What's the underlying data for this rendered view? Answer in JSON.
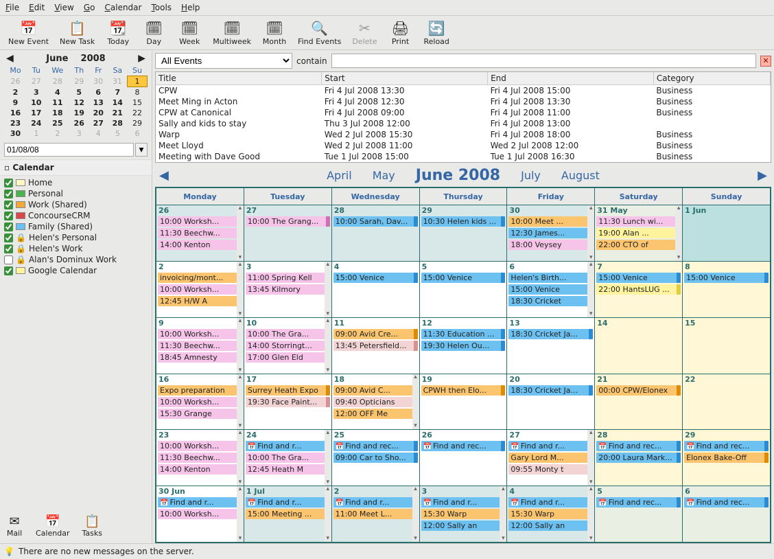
{
  "menubar": [
    "File",
    "Edit",
    "View",
    "Go",
    "Calendar",
    "Tools",
    "Help"
  ],
  "toolbar": [
    {
      "id": "new-event",
      "label": "New Event",
      "icon": "📅"
    },
    {
      "id": "new-task",
      "label": "New Task",
      "icon": "📋"
    },
    {
      "id": "today",
      "label": "Today",
      "icon": "📆"
    },
    {
      "id": "day",
      "label": "Day",
      "icon": "🗓"
    },
    {
      "id": "week",
      "label": "Week",
      "icon": "🗓"
    },
    {
      "id": "multiweek",
      "label": "Multiweek",
      "icon": "🗓"
    },
    {
      "id": "month",
      "label": "Month",
      "icon": "🗓"
    },
    {
      "id": "find-events",
      "label": "Find Events",
      "icon": "🔍"
    },
    {
      "id": "delete",
      "label": "Delete",
      "icon": "✂",
      "disabled": true
    },
    {
      "id": "print",
      "label": "Print",
      "icon": "🖨"
    },
    {
      "id": "reload",
      "label": "Reload",
      "icon": "🔄"
    }
  ],
  "minical": {
    "month": "June",
    "year": "2008",
    "dow": [
      "Mo",
      "Tu",
      "We",
      "Th",
      "Fr",
      "Sa",
      "Su"
    ],
    "rows": [
      [
        {
          "n": "26",
          "g": true
        },
        {
          "n": "27",
          "g": true
        },
        {
          "n": "28",
          "g": true
        },
        {
          "n": "29",
          "g": true
        },
        {
          "n": "30",
          "g": true
        },
        {
          "n": "31",
          "g": true
        },
        {
          "n": "1",
          "sel": true
        }
      ],
      [
        {
          "n": "2",
          "b": true
        },
        {
          "n": "3",
          "b": true
        },
        {
          "n": "4",
          "b": true
        },
        {
          "n": "5",
          "b": true
        },
        {
          "n": "6",
          "b": true
        },
        {
          "n": "7",
          "b": true
        },
        {
          "n": "8"
        }
      ],
      [
        {
          "n": "9",
          "b": true
        },
        {
          "n": "10",
          "b": true
        },
        {
          "n": "11",
          "b": true
        },
        {
          "n": "12",
          "b": true
        },
        {
          "n": "13",
          "b": true
        },
        {
          "n": "14",
          "b": true
        },
        {
          "n": "15"
        }
      ],
      [
        {
          "n": "16",
          "b": true
        },
        {
          "n": "17",
          "b": true
        },
        {
          "n": "18",
          "b": true
        },
        {
          "n": "19",
          "b": true
        },
        {
          "n": "20",
          "b": true
        },
        {
          "n": "21",
          "b": true
        },
        {
          "n": "22"
        }
      ],
      [
        {
          "n": "23",
          "b": true
        },
        {
          "n": "24",
          "b": true
        },
        {
          "n": "25",
          "b": true
        },
        {
          "n": "26",
          "b": true
        },
        {
          "n": "27",
          "b": true
        },
        {
          "n": "28",
          "b": true
        },
        {
          "n": "29"
        }
      ],
      [
        {
          "n": "30",
          "b": true
        },
        {
          "n": "1",
          "g": true
        },
        {
          "n": "2",
          "g": true
        },
        {
          "n": "3",
          "g": true
        },
        {
          "n": "4",
          "g": true
        },
        {
          "n": "5",
          "g": true
        },
        {
          "n": "6",
          "g": true
        }
      ]
    ]
  },
  "date_input": "01/08/08",
  "sidebar_title": "Calendar",
  "calendars": [
    {
      "name": "Home",
      "color": "#fff8c4",
      "checked": true
    },
    {
      "name": "Personal",
      "color": "#4bb34b",
      "checked": true
    },
    {
      "name": "Work (Shared)",
      "color": "#f6a93b",
      "checked": true
    },
    {
      "name": "ConcourseCRM",
      "color": "#d94848",
      "checked": true
    },
    {
      "name": "Family (Shared)",
      "color": "#6dc1f0",
      "checked": true
    },
    {
      "name": "Helen's Personal",
      "color": "#ffffff",
      "checked": true,
      "lock": true
    },
    {
      "name": "Helen's Work",
      "color": "#ffffff",
      "checked": true,
      "lock": true
    },
    {
      "name": "Alan's Dominux Work",
      "color": "#ffffff",
      "checked": false,
      "lock": true
    },
    {
      "name": "Google Calendar",
      "color": "#fff49d",
      "checked": true
    }
  ],
  "switcher": [
    {
      "id": "mail",
      "label": "Mail",
      "icon": "✉"
    },
    {
      "id": "calendar",
      "label": "Calendar",
      "icon": "📅"
    },
    {
      "id": "tasks",
      "label": "Tasks",
      "icon": "📋"
    }
  ],
  "filter": {
    "dropdown": "All Events",
    "label": "contain",
    "value": ""
  },
  "eventlist": {
    "cols": [
      "Title",
      "Start",
      "End",
      "Category"
    ],
    "rows": [
      [
        "CPW",
        "Fri 4 Jul 2008 13:30",
        "Fri 4 Jul 2008 15:00",
        "Business"
      ],
      [
        "Meet Ming in Acton",
        "Fri 4 Jul 2008 12:30",
        "Fri 4 Jul 2008 13:30",
        "Business"
      ],
      [
        "CPW at Canonical",
        "Fri 4 Jul 2008 09:00",
        "Fri 4 Jul 2008 11:00",
        "Business"
      ],
      [
        "Sally and kids to stay",
        "Thu 3 Jul 2008 12:00",
        "Fri 4 Jul 2008 13:00",
        ""
      ],
      [
        "Warp",
        "Wed 2 Jul 2008 15:30",
        "Fri 4 Jul 2008 18:00",
        "Business"
      ],
      [
        "Meet Lloyd",
        "Wed 2 Jul 2008 11:00",
        "Wed 2 Jul 2008 12:00",
        "Business"
      ],
      [
        "Meeting with Dave Good",
        "Tue 1 Jul 2008 15:00",
        "Tue 1 Jul 2008 16:30",
        "Business"
      ]
    ]
  },
  "monthnav": {
    "prev2": "April",
    "prev": "May",
    "cur": "June 2008",
    "next": "July",
    "next2": "August"
  },
  "daynames": [
    "Monday",
    "Tuesday",
    "Wednesday",
    "Thursday",
    "Friday",
    "Saturday",
    "Sunday"
  ],
  "weeks": [
    [
      {
        "n": "26",
        "out": true,
        "sc": true,
        "ev": [
          {
            "t": "10:00 Worksh...",
            "c": "pink"
          },
          {
            "t": "11:30 Beechw...",
            "c": "pink"
          },
          {
            "t": "14:00 Kenton",
            "c": "pink"
          }
        ]
      },
      {
        "n": "27",
        "out": true,
        "ev": [
          {
            "t": "10:00 The Grang...",
            "c": "pink"
          }
        ]
      },
      {
        "n": "28",
        "out": true,
        "ev": [
          {
            "t": "10:00 Sarah, Dav...",
            "c": "blue"
          }
        ]
      },
      {
        "n": "29",
        "out": true,
        "ev": [
          {
            "t": "10:30 Helen kids ...",
            "c": "blue"
          }
        ]
      },
      {
        "n": "30",
        "out": true,
        "sc": true,
        "ev": [
          {
            "t": "10:00 Meet ...",
            "c": "orange"
          },
          {
            "t": "12:30 James...",
            "c": "blue"
          },
          {
            "t": "18:00 Veysey",
            "c": "pink"
          }
        ]
      },
      {
        "n": "31 May",
        "out": true,
        "wknd": true,
        "sc": true,
        "ev": [
          {
            "t": "11:30 Lunch wi...",
            "c": "pink"
          },
          {
            "t": "19:00 Alan ...",
            "c": "yellow"
          },
          {
            "t": "22:00 CTO of",
            "c": "orange"
          }
        ]
      },
      {
        "n": "1 Jun",
        "wknd": true,
        "today": true,
        "ev": []
      }
    ],
    [
      {
        "n": "2",
        "sc": true,
        "ev": [
          {
            "t": "invoicing/mont...",
            "c": "orange"
          },
          {
            "t": "10:00 Worksh...",
            "c": "pink"
          },
          {
            "t": "12:45 H/W A",
            "c": "orange"
          }
        ]
      },
      {
        "n": "3",
        "sc": true,
        "ev": [
          {
            "t": "11:00 Spring Kell",
            "c": "pink"
          },
          {
            "t": "13:45 Kilmory",
            "c": "pink"
          }
        ]
      },
      {
        "n": "4",
        "ev": [
          {
            "t": "15:00 Venice",
            "c": "blue"
          }
        ]
      },
      {
        "n": "5",
        "ev": [
          {
            "t": "15:00 Venice",
            "c": "blue"
          }
        ]
      },
      {
        "n": "6",
        "sc": true,
        "ev": [
          {
            "t": "Helen's Birth...",
            "c": "blue"
          },
          {
            "t": "15:00 Venice",
            "c": "blue"
          },
          {
            "t": "18:30 Cricket",
            "c": "blue"
          }
        ]
      },
      {
        "n": "7",
        "wknd": true,
        "ev": [
          {
            "t": "15:00 Venice",
            "c": "blue"
          },
          {
            "t": "22:00 HantsLUG ...",
            "c": "yellow"
          }
        ]
      },
      {
        "n": "8",
        "wknd": true,
        "ev": [
          {
            "t": "15:00 Venice",
            "c": "blue"
          }
        ]
      }
    ],
    [
      {
        "n": "9",
        "sc": true,
        "ev": [
          {
            "t": "10:00 Worksh...",
            "c": "pink"
          },
          {
            "t": "11:30 Beechw...",
            "c": "pink"
          },
          {
            "t": "18:45 Amnesty",
            "c": "pink"
          }
        ]
      },
      {
        "n": "10",
        "sc": true,
        "ev": [
          {
            "t": "10:00 The Gra...",
            "c": "pink"
          },
          {
            "t": "14:00 Storringt...",
            "c": "pink"
          },
          {
            "t": "17:00 Glen Eld",
            "c": "pink"
          }
        ]
      },
      {
        "n": "11",
        "ev": [
          {
            "t": "09:00 Avid Cre...",
            "c": "orange"
          },
          {
            "t": "13:45 Petersfield...",
            "c": "lpink"
          }
        ]
      },
      {
        "n": "12",
        "ev": [
          {
            "t": "11:30 Education ...",
            "c": "blue"
          },
          {
            "t": "19:30 Helen Ou...",
            "c": "blue"
          }
        ]
      },
      {
        "n": "13",
        "ev": [
          {
            "t": "18:30 Cricket Ja...",
            "c": "blue"
          }
        ]
      },
      {
        "n": "14",
        "wknd": true,
        "ev": []
      },
      {
        "n": "15",
        "wknd": true,
        "ev": []
      }
    ],
    [
      {
        "n": "16",
        "sc": true,
        "ev": [
          {
            "t": "Expo preparation",
            "c": "orange"
          },
          {
            "t": "10:00 Worksh...",
            "c": "pink"
          },
          {
            "t": "15:30 Grange",
            "c": "pink"
          }
        ]
      },
      {
        "n": "17",
        "ev": [
          {
            "t": "Surrey Heath Expo",
            "c": "orange"
          },
          {
            "t": "19:30 Face Paint...",
            "c": "lpink"
          }
        ]
      },
      {
        "n": "18",
        "sc": true,
        "ev": [
          {
            "t": "09:00 Avid C...",
            "c": "orange"
          },
          {
            "t": "09:40 Opticians",
            "c": "lpink"
          },
          {
            "t": "12:00 OFF Me",
            "c": "orange"
          }
        ]
      },
      {
        "n": "19",
        "ev": [
          {
            "t": "CPWH then Elo...",
            "c": "orange"
          }
        ]
      },
      {
        "n": "20",
        "ev": [
          {
            "t": "18:30 Cricket Ja...",
            "c": "blue"
          }
        ]
      },
      {
        "n": "21",
        "wknd": true,
        "ev": [
          {
            "t": "00:00 CPW/Elonex",
            "c": "orange"
          }
        ]
      },
      {
        "n": "22",
        "wknd": true,
        "ev": []
      }
    ],
    [
      {
        "n": "23",
        "sc": true,
        "ev": [
          {
            "t": "10:00 Worksh...",
            "c": "pink"
          },
          {
            "t": "11:30 Beechw...",
            "c": "pink"
          },
          {
            "t": "14:00 Kenton",
            "c": "pink"
          }
        ]
      },
      {
        "n": "24",
        "sc": true,
        "ev": [
          {
            "t": "Find and r...",
            "c": "blue",
            "ico": true
          },
          {
            "t": "10:00 The Gra...",
            "c": "pink"
          },
          {
            "t": "12:45 Heath M",
            "c": "pink"
          }
        ]
      },
      {
        "n": "25",
        "ev": [
          {
            "t": "Find and rec...",
            "c": "blue",
            "ico": true
          },
          {
            "t": "09:00 Car to Sho...",
            "c": "blue"
          }
        ]
      },
      {
        "n": "26",
        "ev": [
          {
            "t": "Find and rec...",
            "c": "blue",
            "ico": true
          }
        ]
      },
      {
        "n": "27",
        "sc": true,
        "ev": [
          {
            "t": "Find and r...",
            "c": "blue",
            "ico": true
          },
          {
            "t": "Gary Lord M...",
            "c": "orange"
          },
          {
            "t": "09:55 Monty t",
            "c": "lpink"
          }
        ]
      },
      {
        "n": "28",
        "wknd": true,
        "ev": [
          {
            "t": "Find and rec...",
            "c": "blue",
            "ico": true
          },
          {
            "t": "20:00 Laura Mark...",
            "c": "blue"
          }
        ]
      },
      {
        "n": "29",
        "wknd": true,
        "ev": [
          {
            "t": "Find and rec...",
            "c": "blue",
            "ico": true
          },
          {
            "t": "Elonex Bake-Off",
            "c": "orange"
          }
        ]
      }
    ],
    [
      {
        "n": "30 Jun",
        "sc": true,
        "ev": [
          {
            "t": "Find and r...",
            "c": "blue",
            "ico": true
          },
          {
            "t": "10:00 Worksh...",
            "c": "pink"
          }
        ]
      },
      {
        "n": "1 Jul",
        "out": true,
        "sc": true,
        "ev": [
          {
            "t": "Find and r...",
            "c": "blue",
            "ico": true
          },
          {
            "t": "15:00 Meeting ...",
            "c": "orange"
          }
        ]
      },
      {
        "n": "2",
        "out": true,
        "sc": true,
        "ev": [
          {
            "t": "Find and r...",
            "c": "blue",
            "ico": true
          },
          {
            "t": "11:00 Meet L...",
            "c": "orange"
          }
        ]
      },
      {
        "n": "3",
        "out": true,
        "sc": true,
        "ev": [
          {
            "t": "Find and r...",
            "c": "blue",
            "ico": true
          },
          {
            "t": "15:30 Warp",
            "c": "orange"
          },
          {
            "t": "12:00 Sally an",
            "c": "blue"
          }
        ]
      },
      {
        "n": "4",
        "out": true,
        "sc": true,
        "ev": [
          {
            "t": "Find and r...",
            "c": "blue",
            "ico": true
          },
          {
            "t": "15:30 Warp",
            "c": "orange"
          },
          {
            "t": "12:00 Sally an",
            "c": "blue"
          }
        ]
      },
      {
        "n": "5",
        "out": true,
        "wknd": true,
        "ev": [
          {
            "t": "Find and rec...",
            "c": "blue",
            "ico": true
          }
        ]
      },
      {
        "n": "6",
        "out": true,
        "wknd": true,
        "ev": [
          {
            "t": "Find and rec...",
            "c": "blue",
            "ico": true
          }
        ]
      }
    ]
  ],
  "status": "There are no new messages on the server."
}
